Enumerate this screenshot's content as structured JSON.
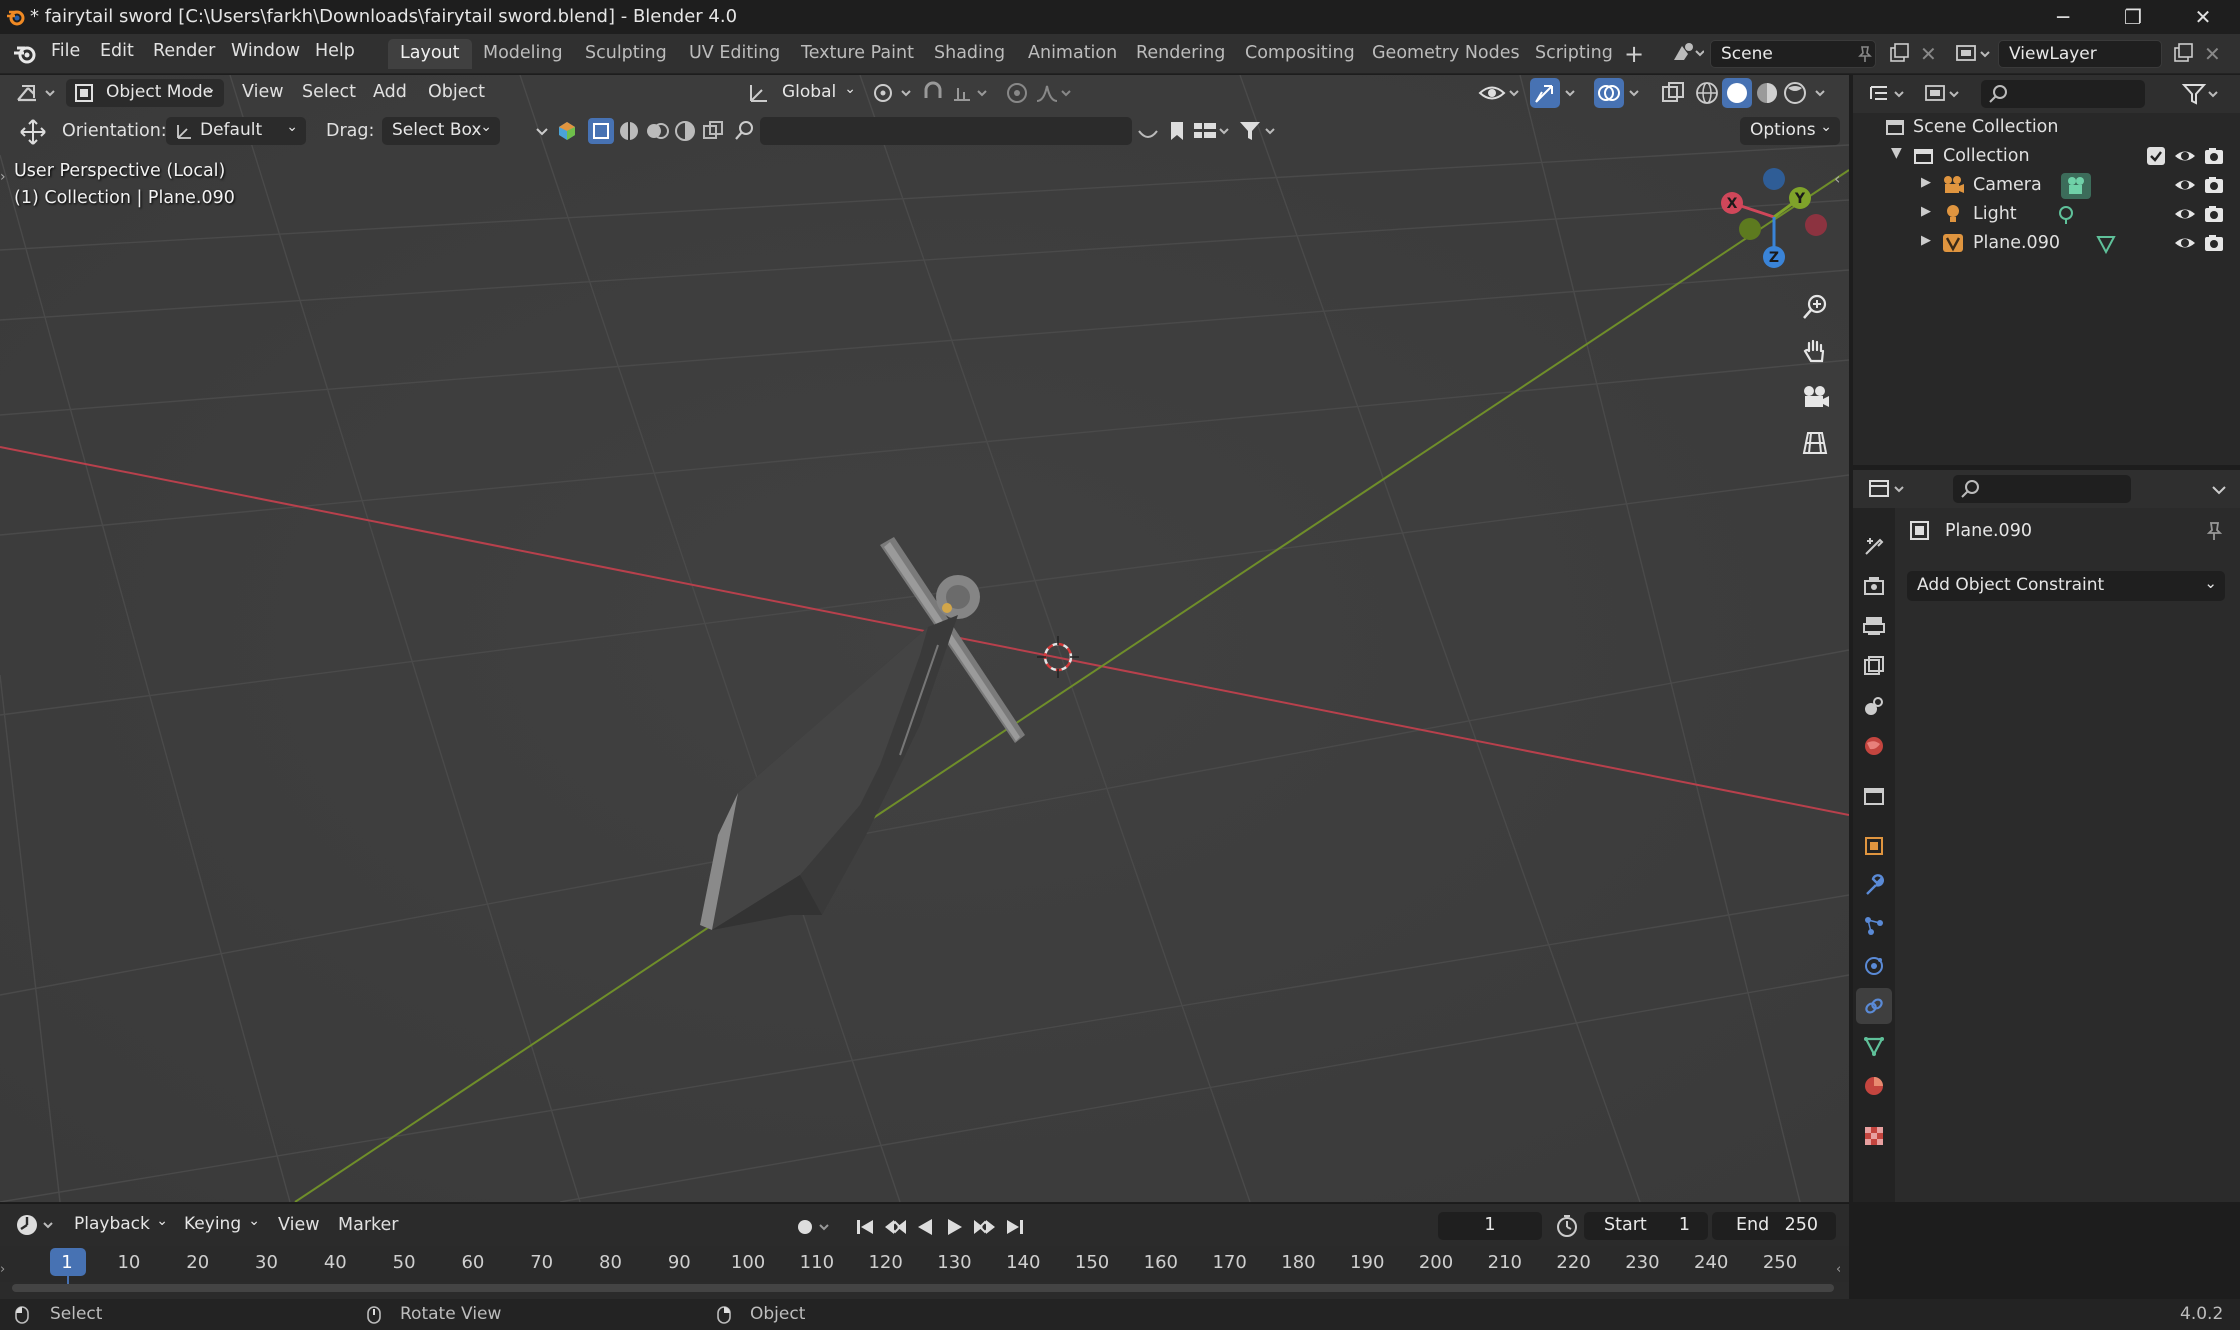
{
  "window": {
    "title": "* fairytail sword [C:\\Users\\farkh\\Downloads\\fairytail sword.blend] - Blender 4.0",
    "minimize": "─",
    "maximize": "❐",
    "close": "✕"
  },
  "menu": {
    "file": "File",
    "edit": "Edit",
    "render": "Render",
    "window": "Window",
    "help": "Help"
  },
  "workspaces": [
    "Layout",
    "Modeling",
    "Sculpting",
    "UV Editing",
    "Texture Paint",
    "Shading",
    "Animation",
    "Rendering",
    "Compositing",
    "Geometry Nodes",
    "Scripting"
  ],
  "active_workspace": "Layout",
  "scene": {
    "label": "Scene",
    "viewlayer": "ViewLayer"
  },
  "viewport_header": {
    "mode": "Object Mode",
    "view": "View",
    "select": "Select",
    "add": "Add",
    "object": "Object",
    "transform": "Global"
  },
  "tool_header": {
    "orientation_label": "Orientation:",
    "orientation_value": "Default",
    "drag_label": "Drag:",
    "drag_value": "Select Box",
    "options": "Options"
  },
  "overlay": {
    "perspective": "User Perspective (Local)",
    "collection": "(1) Collection | Plane.090"
  },
  "gizmo": {
    "x": "X",
    "y": "Y",
    "z": "Z"
  },
  "outliner": {
    "root": "Scene Collection",
    "collection": "Collection",
    "items": [
      {
        "name": "Camera",
        "color": "#e0953f"
      },
      {
        "name": "Light",
        "color": "#e0953f"
      },
      {
        "name": "Plane.090",
        "color": "#e0953f"
      }
    ]
  },
  "properties": {
    "object": "Plane.090",
    "add_constraint": "Add Object Constraint"
  },
  "timeline": {
    "playback": "Playback",
    "keying": "Keying",
    "view": "View",
    "marker": "Marker",
    "current_frame": "1",
    "start_label": "Start",
    "start_value": "1",
    "end_label": "End",
    "end_value": "250",
    "ticks": [
      "1",
      "10",
      "20",
      "30",
      "40",
      "50",
      "60",
      "70",
      "80",
      "90",
      "100",
      "110",
      "120",
      "130",
      "140",
      "150",
      "160",
      "170",
      "180",
      "190",
      "200",
      "210",
      "220",
      "230",
      "240",
      "250"
    ]
  },
  "status": {
    "select": "Select",
    "rotate": "Rotate View",
    "object": "Object",
    "version": "4.0.2"
  },
  "colors": {
    "accent": "#4772b3",
    "x_axis": "#d0475a",
    "y_axis": "#7fa32a",
    "z_axis": "#3a84d8",
    "object_orange": "#e0953f"
  }
}
